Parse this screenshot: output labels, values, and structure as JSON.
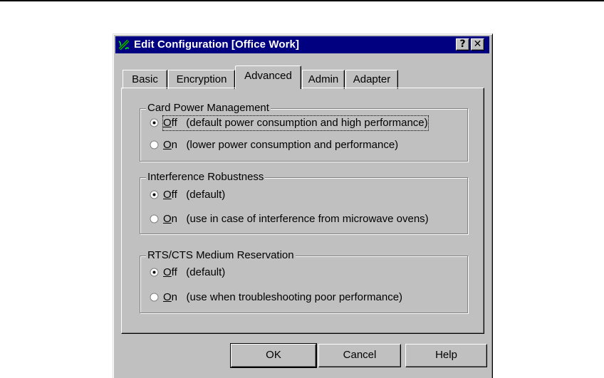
{
  "window": {
    "title": "Edit Configuration [Office Work]",
    "help_glyph": "?",
    "close_glyph": "✕",
    "icon": "wireless-card-icon"
  },
  "tabs": [
    {
      "label": "Basic",
      "active": false
    },
    {
      "label": "Encryption",
      "active": false
    },
    {
      "label": "Advanced",
      "active": true
    },
    {
      "label": "Admin",
      "active": false
    },
    {
      "label": "Adapter",
      "active": false
    }
  ],
  "groups": [
    {
      "title": "Card Power Management",
      "options": [
        {
          "key": "O",
          "rest": "ff",
          "desc": "(default power consumption and high performance)",
          "selected": true
        },
        {
          "key": "O",
          "rest": "n",
          "desc": "(lower power consumption and performance)",
          "selected": false
        }
      ]
    },
    {
      "title": "Interference Robustness",
      "options": [
        {
          "key": "O",
          "rest": "ff",
          "desc": "(default)",
          "selected": true
        },
        {
          "key": "O",
          "rest": "n",
          "desc": "(use in case of interference from microwave ovens)",
          "selected": false
        }
      ]
    },
    {
      "title": "RTS/CTS Medium Reservation",
      "options": [
        {
          "key": "O",
          "rest": "ff",
          "desc": "(default)",
          "selected": true
        },
        {
          "key": "O",
          "rest": "n",
          "desc": "(use when troubleshooting poor performance)",
          "selected": false
        }
      ]
    }
  ],
  "buttons": {
    "ok": "OK",
    "cancel": "Cancel",
    "help": "Help"
  },
  "colors": {
    "titlebar": "#000080",
    "face": "#c0c0c0"
  }
}
